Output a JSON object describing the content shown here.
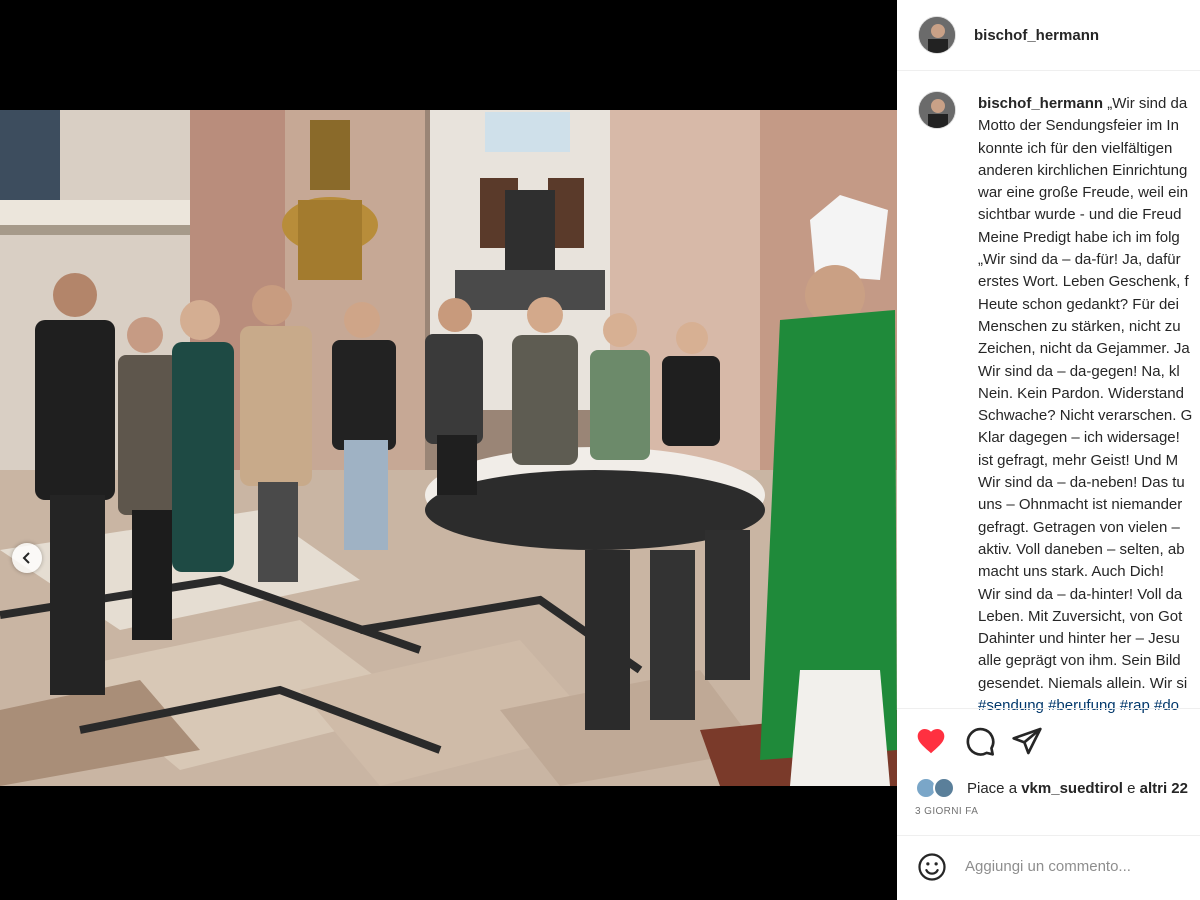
{
  "post": {
    "username": "bischof_hermann",
    "caption_lines": [
      "„Wir sind da",
      "Motto der Sendungsfeier im In",
      "konnte ich für den vielfältigen",
      "anderen kirchlichen Einrichtung",
      "war eine große Freude, weil ein",
      "sichtbar wurde - und die Freud",
      "Meine Predigt habe ich im folg",
      "„Wir sind da – da-für! Ja, dafür",
      "erstes Wort. Leben Geschenk, f",
      "Heute schon gedankt? Für dei",
      "Menschen zu stärken, nicht zu",
      "Zeichen, nicht da Gejammer. Ja",
      "Wir sind da – da-gegen! Na, kl",
      "Nein. Kein Pardon. Widerstand",
      "Schwache? Nicht verarschen. G",
      "Klar dagegen – ich widersage!",
      "ist gefragt, mehr Geist! Und M",
      "Wir sind da – da-neben! Das tu",
      "uns – Ohnmacht ist niemander",
      "gefragt. Getragen von vielen –",
      "aktiv. Voll daneben – selten, ab",
      "macht uns stark. Auch Dich!",
      "Wir sind da – da-hinter! Voll da",
      "Leben. Mit Zuversicht, von Got",
      "Dahinter und hinter her – Jesu",
      "alle geprägt von ihm. Sein Bild",
      "gesendet. Niemals allein. Wir si"
    ],
    "hashtags": "#sendung #berufung #rap #do",
    "likes_prefix": "Piace a",
    "likes_user": "vkm_suedtirol",
    "likes_connector": "e",
    "likes_others": "altri 22",
    "date": "3 GIORNI FA",
    "comment_placeholder": "Aggiungi un commento..."
  },
  "carousel": {
    "total": 5,
    "active_index": 4
  },
  "colors": {
    "heart": "#ff3040",
    "text": "#262626",
    "muted": "#737373",
    "hashtag": "#00376b",
    "vestment": "#1f8a3a"
  },
  "icons": {
    "like": "heart-filled-icon",
    "comment": "speech-bubble-icon",
    "share": "paper-plane-icon",
    "emoji": "smiley-icon",
    "prev": "chevron-left-icon"
  }
}
